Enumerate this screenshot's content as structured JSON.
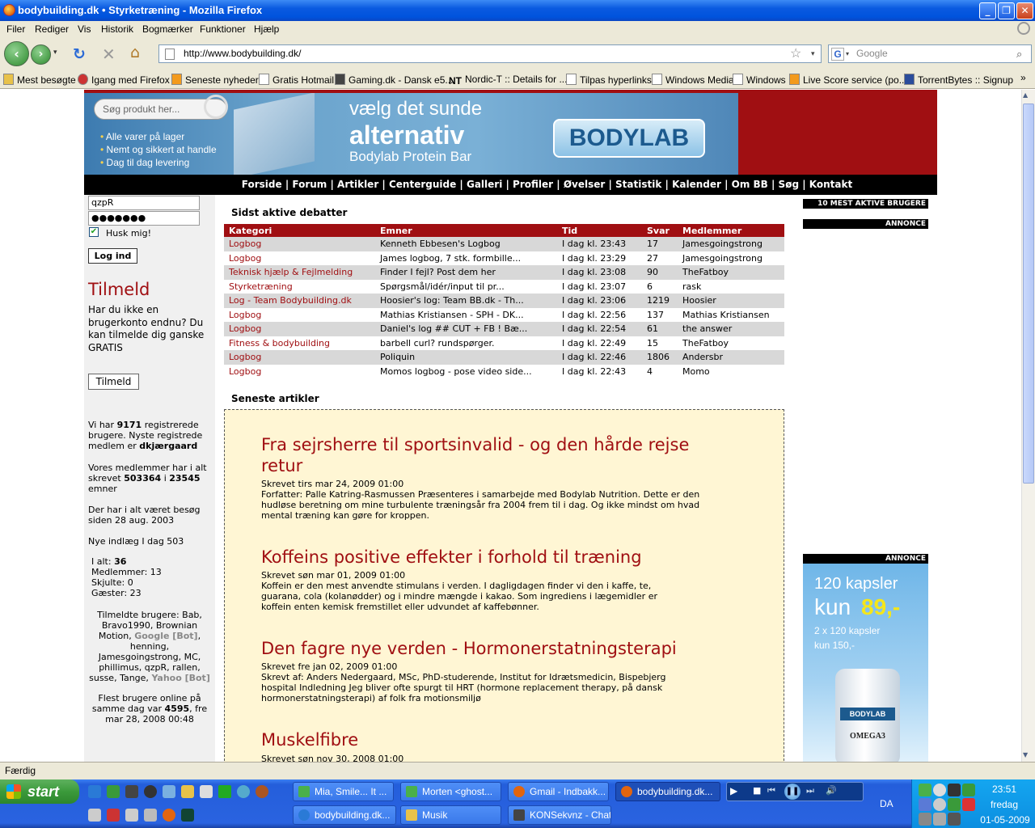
{
  "window": {
    "title": "bodybuilding.dk • Styrketræning - Mozilla Firefox"
  },
  "menu": [
    "Filer",
    "Rediger",
    "Vis",
    "Historik",
    "Bogmærker",
    "Funktioner",
    "Hjælp"
  ],
  "address": {
    "url": "http://www.bodybuilding.dk/"
  },
  "search": {
    "placeholder": "Google"
  },
  "bookmarks": [
    "Mest besøgte",
    "Igang med Firefox",
    "Seneste nyheder",
    "Gratis Hotmail",
    "Gaming.dk - Dansk e5...",
    "Nordic-T :: Details for ...",
    "Tilpas hyperlinks",
    "Windows Media",
    "Windows",
    "Live Score service (po...",
    "TorrentBytes :: Signup"
  ],
  "banner": {
    "search_placeholder": "Søg produkt her...",
    "bullets": [
      "Alle varer på lager",
      "Nemt og sikkert at handle",
      "Dag til dag levering"
    ],
    "headline_1": "vælg det sunde",
    "headline_2": "alternativ",
    "headline_3": "Bodylab Protein Bar",
    "brand": "BODYLAB"
  },
  "sitenav": "Forside | Forum | Artikler | Centerguide | Galleri | Profiler | Øvelser | Statistik | Kalender | Om BB | Søg | Kontakt",
  "login": {
    "username": "qzpR",
    "password": "●●●●●●●",
    "remember": "Husk mig!",
    "button": "Log ind"
  },
  "signup": {
    "title": "Tilmeld",
    "text": "Har du ikke en brugerkonto endnu? Du kan tilmelde dig ganske GRATIS",
    "button": "Tilmeld"
  },
  "stats": {
    "reg_1": "Vi har",
    "reg_count": "9171",
    "reg_2": "registrerede brugere. Nyste registrede medlem er",
    "newest": "dkjærgaard",
    "posts_1": "Vores medlemmer har i alt skrevet",
    "posts": "503364",
    "posts_2": "i",
    "topics": "23545",
    "posts_3": "emner",
    "visited": "Der har i alt været besøg siden 28 aug. 2003",
    "new_today": "Nye indlæg I dag 503",
    "total_label": "I alt:",
    "total": "36",
    "members": "Medlemmer: 13",
    "hidden": "Skjulte: 0",
    "guests": "Gæster: 23",
    "online_label": "Tilmeldte brugere: Bab, Bravo1990, Brownian Motion,",
    "bot1": "Google [Bot]",
    "online_label_2": ", henning, Jamesgoingstrong, MC, phillimus, qzpR, rallen, susse, Tange,",
    "bot2": "Yahoo [Bot]",
    "record_1": "Flest brugere online på samme dag var",
    "record": "4595",
    "record_2": ", fre mar 28, 2008 00:48"
  },
  "debates": {
    "title": "Sidst aktive debatter",
    "headers": [
      "Kategori",
      "Emner",
      "Tid",
      "Svar",
      "Medlemmer"
    ],
    "rows": [
      [
        "Logbog",
        "Kenneth Ebbesen's Logbog",
        "I dag kl. 23:43",
        "17",
        "Jamesgoingstrong"
      ],
      [
        "Logbog",
        "James logbog, 7 stk. formbille...",
        "I dag kl. 23:29",
        "27",
        "Jamesgoingstrong"
      ],
      [
        "Teknisk hjælp & Fejlmelding",
        "Finder I fejl? Post dem her",
        "I dag kl. 23:08",
        "90",
        "TheFatboy"
      ],
      [
        "Styrketræning",
        "Spørgsmål/idér/input til pr...",
        "I dag kl. 23:07",
        "6",
        "rask"
      ],
      [
        "Log - Team Bodybuilding.dk",
        "Hoosier's log: Team BB.dk - Th...",
        "I dag kl. 23:06",
        "1219",
        "Hoosier"
      ],
      [
        "Logbog",
        "Mathias Kristiansen - SPH - DK...",
        "I dag kl. 22:56",
        "137",
        "Mathias Kristiansen"
      ],
      [
        "Logbog",
        "Daniel's log ## CUT + FB ! Bæ...",
        "I dag kl. 22:54",
        "61",
        "the answer"
      ],
      [
        "Fitness & bodybuilding",
        "barbell curl? rundspørger.",
        "I dag kl. 22:49",
        "15",
        "TheFatboy"
      ],
      [
        "Logbog",
        "Poliquin",
        "I dag kl. 22:46",
        "1806",
        "Andersbr"
      ],
      [
        "Logbog",
        "Momos logbog - pose video side...",
        "I dag kl. 22:43",
        "4",
        "Momo"
      ]
    ]
  },
  "articles": {
    "title": "Seneste artikler",
    "items": [
      {
        "title": "Fra sejrsherre til sportsinvalid - og den hårde rejse retur",
        "date": "Skrevet tirs mar 24, 2009 01:00",
        "text": "Forfatter: Palle Katring-Rasmussen Præsenteres i samarbejde med Bodylab Nutrition. Dette er den hudløse beretning om mine turbulente træningsår fra 2004 frem til i dag. Og ikke mindst om hvad mental træning kan gøre for kroppen."
      },
      {
        "title": "Koffeins positive effekter i forhold til træning",
        "date": "Skrevet søn mar 01, 2009 01:00",
        "text": "Koffein er den mest anvendte stimulans i verden. I dagligdagen finder vi den i kaffe, te, guarana, cola (kolanødder) og i mindre mængde i kakao. Som ingrediens i lægemidler er koffein enten kemisk fremstillet eller udvundet af kaffebønner."
      },
      {
        "title": "Den fagre nye verden - Hormonerstatningsterapi",
        "date": "Skrevet fre jan 02, 2009 01:00",
        "text": "Skrevt af: Anders Nedergaard, MSc, PhD-studerende, Institut for Idrætsmedicin, Bispebjerg hospital Indledning Jeg bliver ofte spurgt til HRT (hormone replacement therapy, på dansk hormonerstatningsterapi) af folk fra motionsmiljø"
      },
      {
        "title": "Muskelfibre",
        "date": "Skrevet søn nov 30, 2008 01:00",
        "text": ""
      }
    ]
  },
  "rightcol": {
    "active_users": "10 MEST AKTIVE BRUGERE",
    "ad1": "ANNONCE",
    "ad2": "ANNONCE",
    "ad_line1": "120 kapsler",
    "ad_line2": "kun",
    "ad_price": "89,-",
    "ad_line3": "2 x 120 kapsler",
    "ad_line4": "kun 150,-",
    "ad_brand": "BODYLAB",
    "ad_product": "OMEGA3"
  },
  "status": "Færdig",
  "taskbar": {
    "start": "start",
    "row1": [
      "Mia, Smile... It ...",
      "Morten <ghost...",
      "Gmail - Indbakk...",
      "bodybuilding.dk..."
    ],
    "row2": [
      "bodybuilding.dk...",
      "Musik",
      "KONSekvnz - Chat"
    ],
    "lang": "DA",
    "time": "23:51",
    "day": "fredag",
    "date": "01-05-2009"
  }
}
